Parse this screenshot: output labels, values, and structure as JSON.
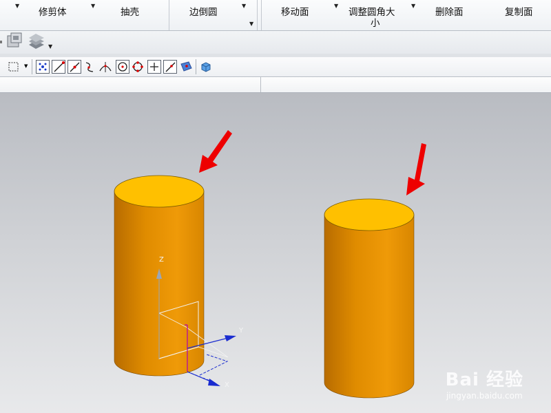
{
  "ribbon": {
    "items": [
      {
        "label": "修剪体",
        "has_dropdown": true
      },
      {
        "label": "抽壳",
        "has_dropdown": false
      },
      {
        "label": "边倒圆",
        "has_dropdown": true
      },
      {
        "label": "移动面",
        "has_dropdown": true
      },
      {
        "label": "调整圆角大",
        "label_line2": "小",
        "has_dropdown": true
      },
      {
        "label": "删除面",
        "has_dropdown": false
      },
      {
        "label": "复制面",
        "has_dropdown": false
      }
    ]
  },
  "layer_toolbar": {
    "icons": [
      "layer-settings-icon",
      "layer-stack-icon",
      "more-dropdown-icon"
    ]
  },
  "selection_toolbar": {
    "icons": [
      "box-select-icon",
      "snap-all-points-icon",
      "snap-end-point-icon",
      "snap-mid-point-icon",
      "snap-control-point-icon",
      "snap-intersection-icon",
      "snap-arc-center-icon",
      "snap-quadrant-icon",
      "snap-existing-point-icon",
      "snap-point-on-curve-icon",
      "snap-point-on-face-icon",
      "box-view-icon"
    ]
  },
  "viewport": {
    "axes": {
      "x": "X",
      "y": "Y",
      "z": "Z"
    },
    "colors": {
      "cylinder_side": "#e08c00",
      "cylinder_top": "#ffc000",
      "arrow": "#e00000"
    }
  },
  "watermark": {
    "brand": "Bai 经验",
    "url": "jingyan.baidu.com"
  }
}
